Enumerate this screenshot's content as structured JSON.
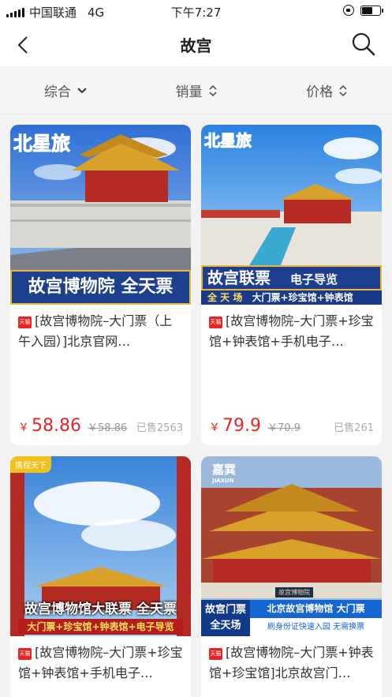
{
  "status": {
    "carrier": "中国联通",
    "network": "4G",
    "time": "下午7:27",
    "battery_level": 0.6
  },
  "nav": {
    "title": "故宫",
    "back_icon": "chevron-left-icon",
    "search_icon": "search-icon"
  },
  "filters": [
    {
      "label": "综合",
      "icon": "chevron-down-icon"
    },
    {
      "label": "销量",
      "icon": "sort-updown-icon"
    },
    {
      "label": "价格",
      "icon": "sort-updown-icon"
    }
  ],
  "products": [
    {
      "badge": "天猫",
      "name": "[故宫博物院–大门票（上午入园）]北京官网…",
      "yen": "￥",
      "price": "58.86",
      "orig": "￥58.86",
      "sold": "已售2563",
      "img": {
        "brand": "北星旅",
        "title": "故宫博物院  全天票"
      }
    },
    {
      "badge": "天猫",
      "name": "[故宫博物院–大门票+珍宝馆+钟表馆+手机电子…",
      "yen": "￥",
      "price": "79.9",
      "orig": "￥70.9",
      "sold": "已售261",
      "img": {
        "brand": "北星旅",
        "title": "故宫联票",
        "subtitle": "电子导览",
        "strip_label": "全 天 场",
        "strip_items": "大门票+珍宝馆+钟表馆"
      }
    },
    {
      "badge": "天猫",
      "name": "[故宫博物院–大门票+珍宝馆+钟表馆+手机电子…",
      "img": {
        "brand": "携程天下",
        "title": "故宫博物馆大联票 全天票",
        "strip_items": "大门票+珍宝馆+钟表馆+电子导览"
      }
    },
    {
      "badge": "天猫",
      "name": "[故宫博物院–大门票+钟表馆+珍宝馆]北京故宫门…",
      "img": {
        "brand": "嘉巽",
        "brand_en": "JIAXUN",
        "plaque": "故宫博物院",
        "left_title": "故宫门票",
        "left_sub": "全天场",
        "right_title": "北京故宫博物馆 大门票",
        "right_sub": "刷身份证快速入园 无需换票"
      }
    }
  ],
  "colors": {
    "price": "#e4262b",
    "tmall": "#e22222",
    "palace_red": "#b52a22",
    "roof_gold": "#d8a12a"
  }
}
